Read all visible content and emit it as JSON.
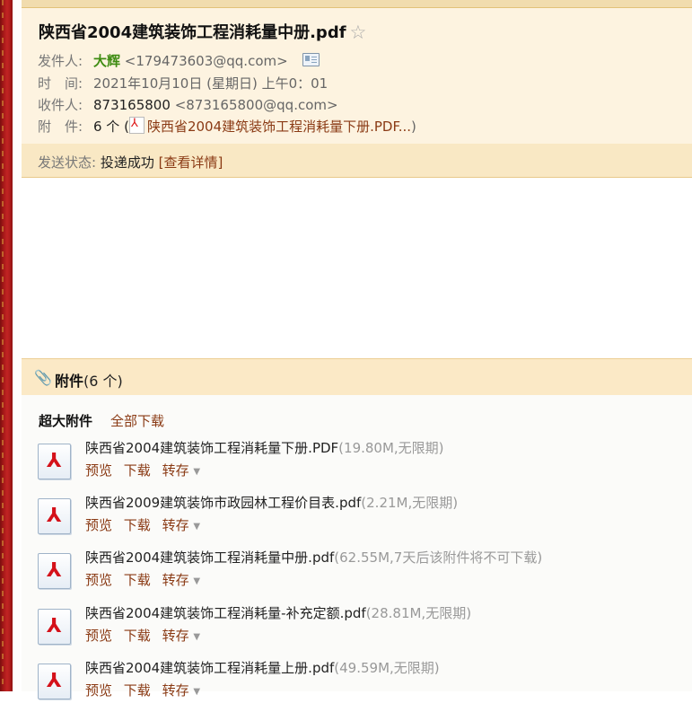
{
  "mail": {
    "subject": "陕西省2004建筑装饰工程消耗量中册.pdf",
    "sender_label": "发件人:",
    "sender_name": "大辉",
    "sender_email": "<179473603@qq.com>",
    "time_label": "时　间:",
    "time_value": "2021年10月10日 (星期日) 上午0：01",
    "recipient_label": "收件人:",
    "recipient_name": "873165800",
    "recipient_email": "<873165800@qq.com>",
    "attach_label": "附　件:",
    "attach_count": "6 个 (",
    "attach_first": "陕西省2004建筑装饰工程消耗量下册.PDF...",
    "attach_close": ")",
    "status_label": "发送状态:",
    "status_value": "投递成功",
    "status_detail": "[查看详情]"
  },
  "attachments": {
    "title": "附件",
    "count": "(6 个)",
    "section_label": "超大附件",
    "download_all": "全部下载",
    "action_preview": "预览",
    "action_download": "下载",
    "action_save": "转存",
    "files": [
      {
        "name": "陕西省2004建筑装饰工程消耗量下册.PDF",
        "meta": "(19.80M,无限期)"
      },
      {
        "name": "陕西省2009建筑装饰市政园林工程价目表.pdf",
        "meta": "(2.21M,无限期)"
      },
      {
        "name": "陕西省2004建筑装饰工程消耗量中册.pdf",
        "meta": "(62.55M,7天后该附件将不可下载)"
      },
      {
        "name": "陕西省2004建筑装饰工程消耗量-补充定额.pdf",
        "meta": "(28.81M,无限期)"
      },
      {
        "name": "陕西省2004建筑装饰工程消耗量上册.pdf",
        "meta": "(49.59M,无限期)"
      }
    ]
  },
  "colors": {
    "accent_link": "#8a3a14",
    "sender_green": "#3f8c12",
    "header_bg": "#fdf3e0",
    "strip_red": "#b01c1c"
  }
}
